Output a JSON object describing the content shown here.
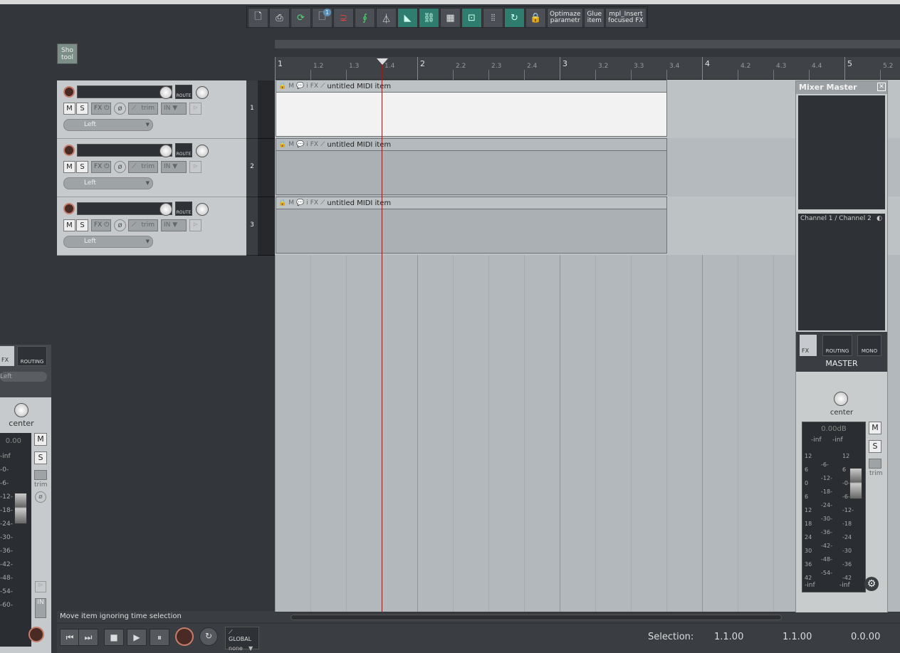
{
  "toolbar": {
    "optimize_label": "Optimaze\nparametr",
    "glue_label": "Glue\nitem",
    "insert_fx_label": "mpl_Insert\nfocused FX",
    "badge": "1"
  },
  "sho_tool": {
    "label": "Sho\ntool"
  },
  "ruler": {
    "labels": [
      "1",
      "1.2",
      "1.3",
      "1.4",
      "2",
      "2.2",
      "2.3",
      "2.4",
      "3",
      "3.2",
      "3.3",
      "3.4",
      "4",
      "4.2",
      "4.3",
      "4.4",
      "5",
      "5.2"
    ]
  },
  "tracks": [
    {
      "number": "1",
      "fx": "FX",
      "trim": "trim",
      "input": "IN",
      "channel": "Left",
      "mute": "M",
      "solo": "S",
      "route": "ROUTE",
      "item": "untitled MIDI item"
    },
    {
      "number": "2",
      "fx": "FX",
      "trim": "trim",
      "input": "IN",
      "channel": "Left",
      "mute": "M",
      "solo": "S",
      "route": "ROUTE",
      "item": "untitled MIDI item"
    },
    {
      "number": "3",
      "fx": "FX",
      "trim": "trim",
      "input": "IN",
      "channel": "Left",
      "mute": "M",
      "solo": "S",
      "route": "ROUTE",
      "item": "untitled MIDI item"
    }
  ],
  "item_icons": [
    "🔒",
    "M",
    "💬",
    "i",
    "FX",
    "⟋"
  ],
  "left_strip": {
    "fx": "FX",
    "routing": "ROUTING",
    "channel": "Left",
    "pan": "center",
    "volume": "0.00",
    "mute": "M",
    "solo": "S",
    "trim": "trim",
    "input": "IN",
    "scale": [
      "-inf",
      "-0-",
      "-6-",
      "-12-",
      "-18-",
      "-24-",
      "-30-",
      "-36-",
      "-42-",
      "-48-",
      "-54-",
      "-60-"
    ]
  },
  "mixer_master": {
    "title": "Mixer Master",
    "close": "✕",
    "channel_select": "Channel 1 / Channel 2",
    "fx": "FX",
    "routing": "ROUTING",
    "mono": "MONO",
    "name": "MASTER",
    "pan": "center",
    "volume": "0.00dB",
    "peak_left": "-inf",
    "peak_right": "-inf",
    "mute": "M",
    "solo": "S",
    "trim": "trim",
    "scale_left": [
      "12",
      "6",
      "0",
      "6",
      "12",
      "18",
      "24",
      "30",
      "36",
      "42"
    ],
    "scale_mid": [
      "-6-",
      "-12-",
      "-18-",
      "-24-",
      "-30-",
      "-36-",
      "-42-",
      "-48-",
      "-54-"
    ],
    "scale_right": [
      "12",
      "6",
      "-0-",
      "-6-",
      "-12-",
      "-18",
      "-24",
      "-30",
      "-36",
      "-42"
    ],
    "bottom_left": "-inf",
    "bottom_right": "-inf"
  },
  "status": {
    "text": "Move item ignoring time selection"
  },
  "transport": {
    "global_label": "GLOBAL",
    "automation_mode": "none",
    "selection_label": "Selection:",
    "selection_start": "1.1.00",
    "selection_end": "1.1.00",
    "selection_length": "0.0.00"
  }
}
